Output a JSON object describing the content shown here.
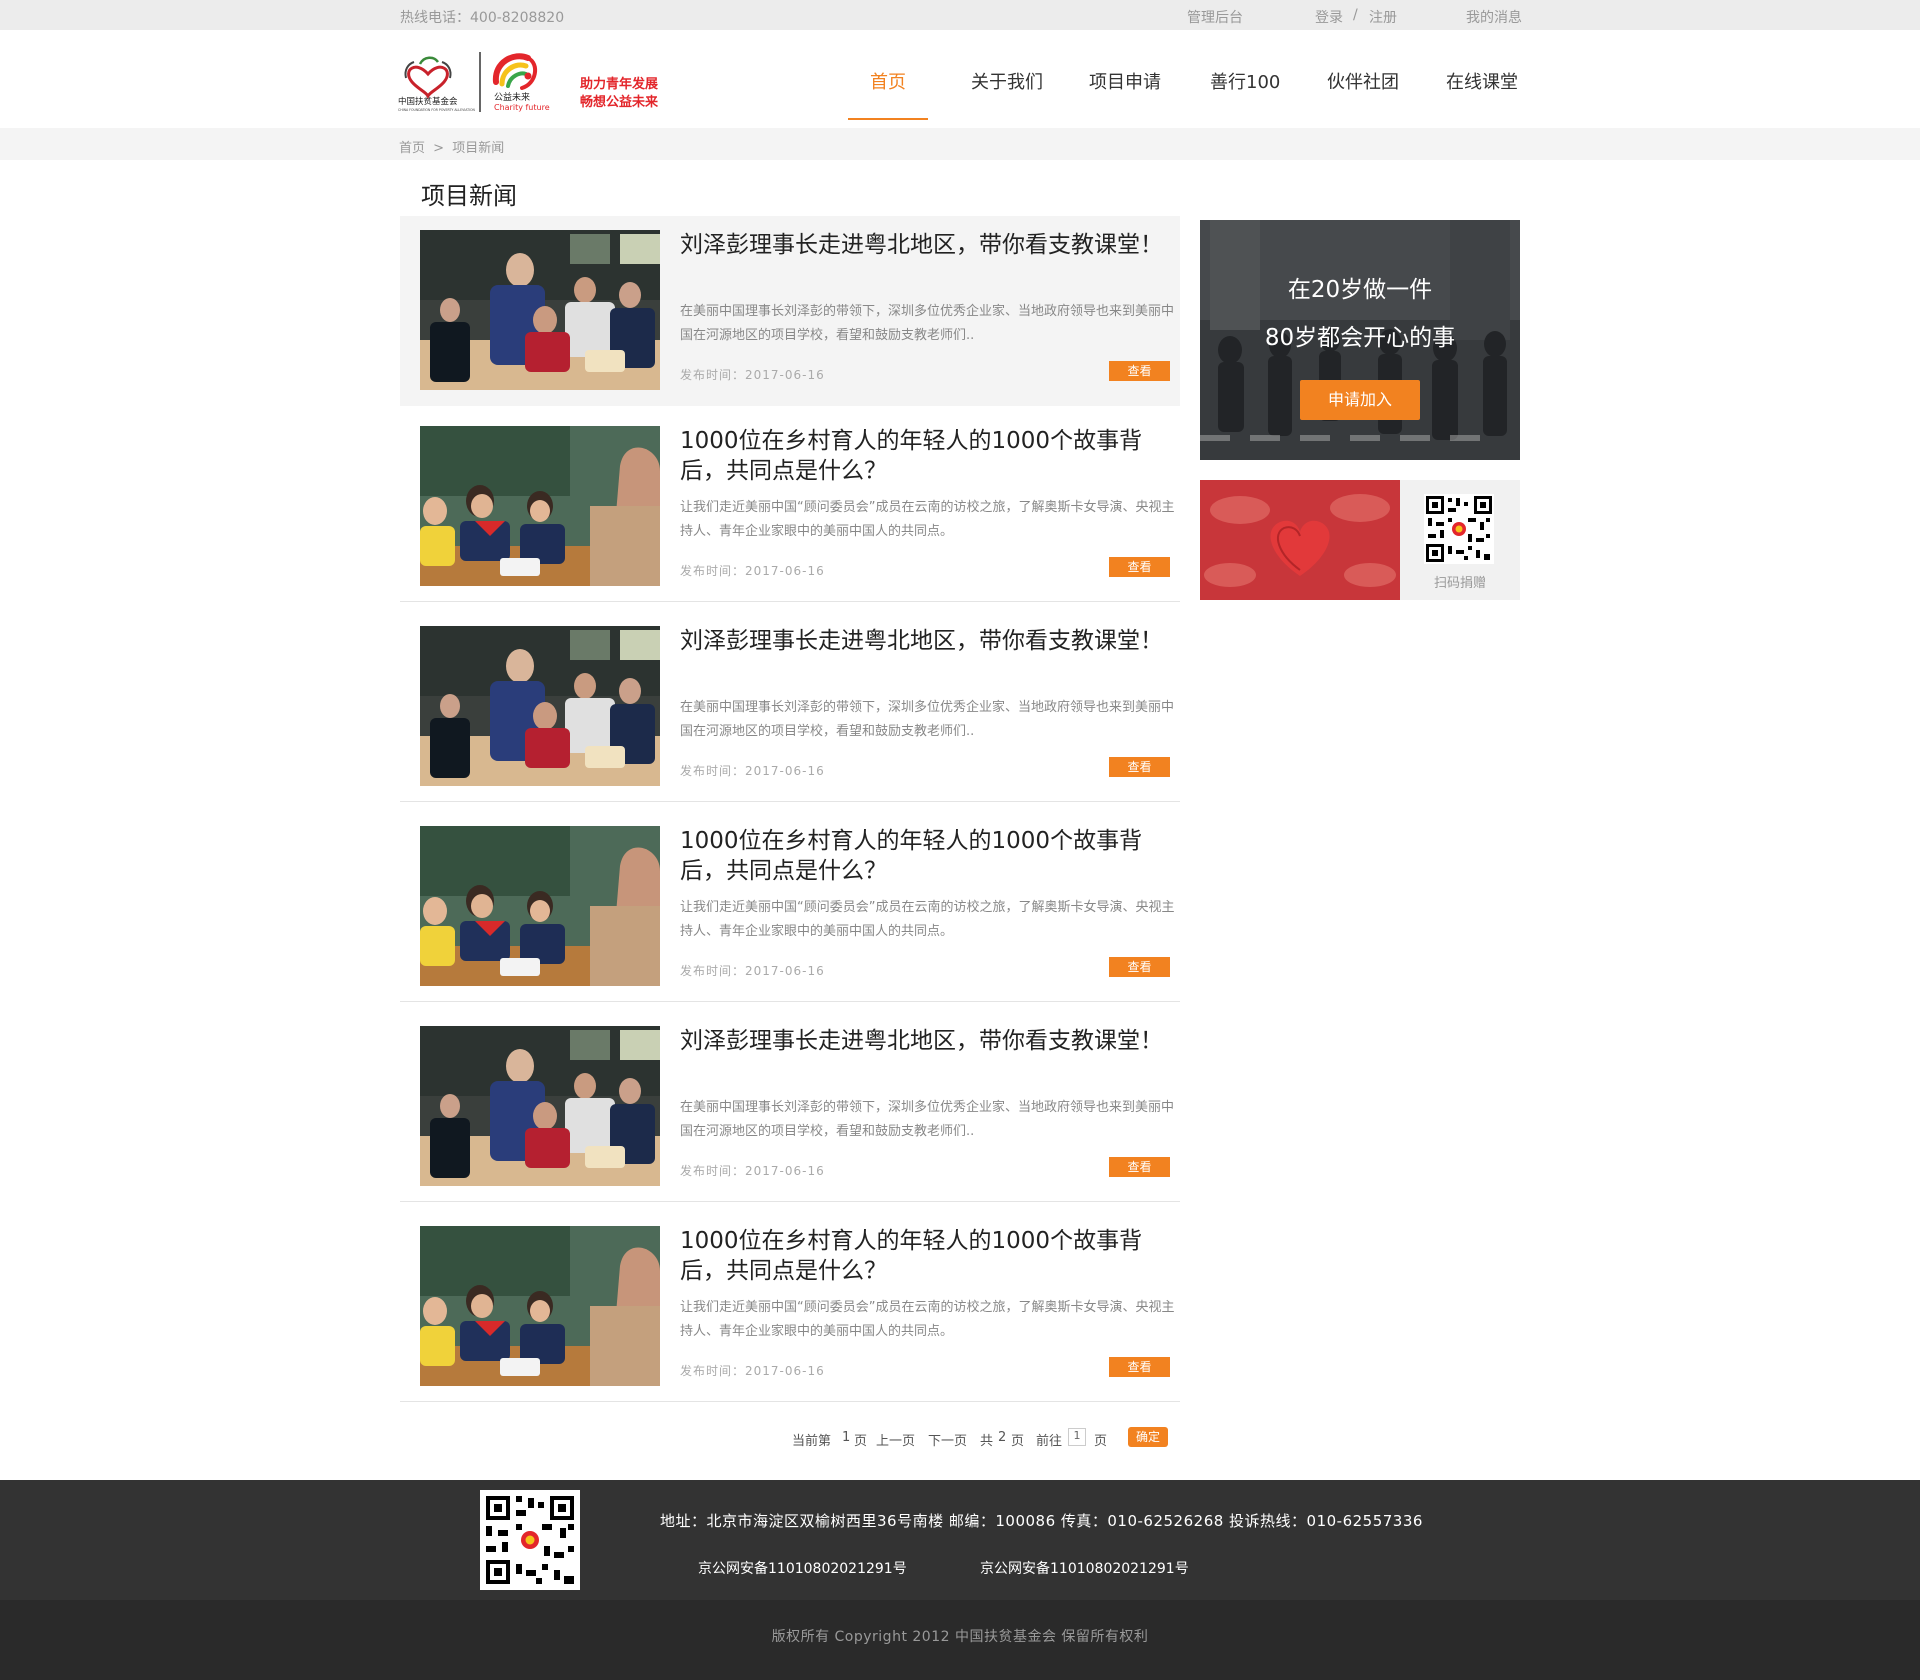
{
  "topbar": {
    "hotline": "热线电话：400-8208820",
    "admin": "管理后台",
    "login": "登录",
    "separator": "/",
    "register": "注册",
    "messages": "我的消息"
  },
  "header": {
    "logo": {
      "foundation_name": "中国扶贫基金会",
      "foundation_name_en": "CHINA FOUNDATION FOR POVERTY ALLEVIATION",
      "brand_name": "公益未来",
      "brand_name_en": "Charity future",
      "slogan_line1": "助力青年发展",
      "slogan_line2": "畅想公益未来"
    },
    "nav": [
      {
        "label": "首页",
        "active": true
      },
      {
        "label": "关于我们",
        "active": false
      },
      {
        "label": "项目申请",
        "active": false
      },
      {
        "label": "善行100",
        "active": false
      },
      {
        "label": "伙伴社团",
        "active": false
      },
      {
        "label": "在线课堂",
        "active": false
      }
    ]
  },
  "breadcrumb": {
    "home": "首页",
    "separator": ">",
    "current": "项目新闻"
  },
  "main": {
    "page_title": "项目新闻",
    "news": [
      {
        "title": "刘泽彭理事长走进粤北地区，带你看支教课堂！",
        "summary": "在美丽中国理事长刘泽彭的带领下，深圳多位优秀企业家、当地政府领导也来到美丽中国在河源地区的项目学校，看望和鼓励支教老师们..",
        "date": "发布时间：2017-06-16",
        "button": "查看",
        "image": "classroom-elder"
      },
      {
        "title": "1000位在乡村育人的年轻人的1000个故事背后，共同点是什么？",
        "summary": "让我们走近美丽中国“顾问委员会”成员在云南的访校之旅，了解奥斯卡女导演、央视主持人、青年企业家眼中的美丽中国人的共同点。",
        "date": "发布时间：2017-06-16",
        "button": "查看",
        "image": "classroom-teacher"
      },
      {
        "title": "刘泽彭理事长走进粤北地区，带你看支教课堂！",
        "summary": "在美丽中国理事长刘泽彭的带领下，深圳多位优秀企业家、当地政府领导也来到美丽中国在河源地区的项目学校，看望和鼓励支教老师们..",
        "date": "发布时间：2017-06-16",
        "button": "查看",
        "image": "classroom-elder"
      },
      {
        "title": "1000位在乡村育人的年轻人的1000个故事背后，共同点是什么？",
        "summary": "让我们走近美丽中国“顾问委员会”成员在云南的访校之旅，了解奥斯卡女导演、央视主持人、青年企业家眼中的美丽中国人的共同点。",
        "date": "发布时间：2017-06-16",
        "button": "查看",
        "image": "classroom-teacher"
      },
      {
        "title": "刘泽彭理事长走进粤北地区，带你看支教课堂！",
        "summary": "在美丽中国理事长刘泽彭的带领下，深圳多位优秀企业家、当地政府领导也来到美丽中国在河源地区的项目学校，看望和鼓励支教老师们..",
        "date": "发布时间：2017-06-16",
        "button": "查看",
        "image": "classroom-elder"
      },
      {
        "title": "1000位在乡村育人的年轻人的1000个故事背后，共同点是什么？",
        "summary": "让我们走近美丽中国“顾问委员会”成员在云南的访校之旅，了解奥斯卡女导演、央视主持人、青年企业家眼中的美丽中国人的共同点。",
        "date": "发布时间：2017-06-16",
        "button": "查看",
        "image": "classroom-teacher"
      }
    ],
    "pagination": {
      "current_prefix": "当前第",
      "current_page": "1",
      "page_unit": "页",
      "prev": "上一页",
      "next": "下一页",
      "total_prefix": "共",
      "total_pages": "2",
      "total_suffix": "页",
      "goto_prefix": "前往",
      "goto_value": "1",
      "goto_suffix": "页",
      "confirm": "确定"
    }
  },
  "sidebar": {
    "promo": {
      "line1": "在20岁做一件",
      "line2": "80岁都会开心的事",
      "button": "申请加入"
    },
    "donate": {
      "qr_label": "扫码捐赠"
    }
  },
  "footer": {
    "address": "地址：北京市海淀区双榆树西里36号南楼 邮编：100086 传真：010-62526268 投诉热线：010-62557336",
    "icp_1": "京公网安备11010802021291号",
    "icp_2": "京公网安备11010802021291号",
    "copyright": "版权所有 Copyright 2012 中国扶贫基金会 保留所有权利"
  },
  "colors": {
    "accent": "#f28220",
    "topbar_bg": "#ececec",
    "footer_bg": "#333333",
    "footer_bottom_bg": "#2a2a2a"
  }
}
